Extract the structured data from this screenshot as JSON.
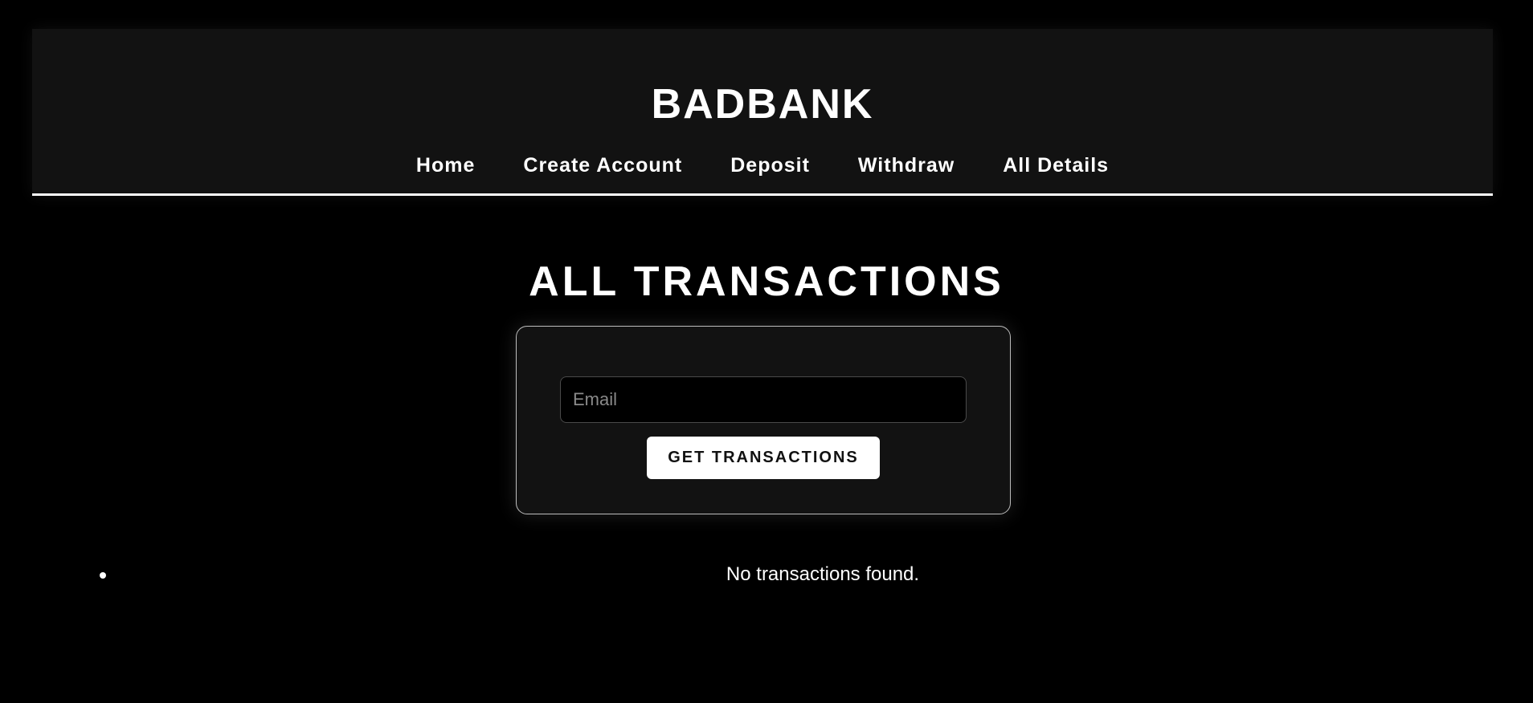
{
  "app": {
    "brand": "BADBANK"
  },
  "nav": {
    "items": [
      {
        "label": "Home"
      },
      {
        "label": "Create Account"
      },
      {
        "label": "Deposit"
      },
      {
        "label": "Withdraw"
      },
      {
        "label": "All Details"
      }
    ]
  },
  "main": {
    "title": "ALL TRANSACTIONS",
    "form": {
      "email_placeholder": "Email",
      "email_value": "",
      "submit_label": "GET TRANSACTIONS"
    },
    "transactions": {
      "empty_message": "No transactions found."
    }
  },
  "theme": {
    "background": "#000000",
    "panel": "#121212",
    "text": "#ffffff",
    "button_bg": "#ffffff",
    "button_text": "#111111"
  }
}
